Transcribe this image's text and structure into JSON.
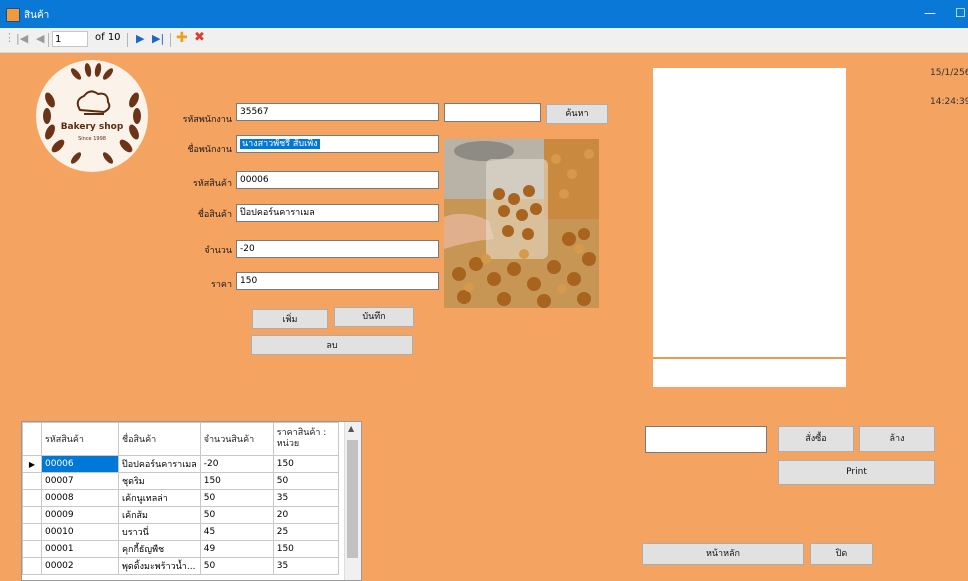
{
  "window": {
    "title": "สินค้า"
  },
  "toolbar": {
    "position": "1",
    "of_label": "of 10"
  },
  "logo": {
    "brand": "Bakery shop",
    "since": "Since 1998"
  },
  "form": {
    "employee_id_label": "รหัสพนักงาน",
    "employee_id": "35567",
    "employee_name_label": "ชื่อพนักงาน",
    "employee_name": "นางสาวพัชรี สับเพิ่ง",
    "product_id_label": "รหัสสินค้า",
    "product_id": "00006",
    "product_name_label": "ชื่อสินค้า",
    "product_name": "ป๊อปคอร์นคาราเมล",
    "quantity_label": "จำนวน",
    "quantity": "-20",
    "price_label": "ราคา",
    "price": "150",
    "search_value": "",
    "search_button": "ค้นหา",
    "add_button": "เพิ่ม",
    "save_button": "บันทึก",
    "delete_button": "ลบ"
  },
  "status": {
    "date": "15/1/256",
    "time": "14:24:39"
  },
  "right": {
    "order_input": "",
    "order_button": "สั่งซื้อ",
    "clear_button": "ล้าง",
    "print_button": "Print",
    "home_button": "หน้าหลัก",
    "close_button": "ปิด"
  },
  "grid": {
    "columns": [
      "รหัสสินค้า",
      "ชื่อสินค้า",
      "จำนวนสินค้า",
      "ราคาสินค้า : หน่วย"
    ],
    "rows": [
      [
        "00006",
        "ป๊อปคอร์นคาราเมล",
        "-20",
        "150"
      ],
      [
        "00007",
        "ชุดริม",
        "150",
        "50"
      ],
      [
        "00008",
        "เค้กนูเทลล่า",
        "50",
        "35"
      ],
      [
        "00009",
        "เค้กส้ม",
        "50",
        "20"
      ],
      [
        "00010",
        "บราวนี่",
        "45",
        "25"
      ],
      [
        "00001",
        "คุกกี้ธัญพืช",
        "49",
        "150"
      ],
      [
        "00002",
        "พุดดิ้งมะพร้าวน้ำ...",
        "50",
        "35"
      ]
    ]
  },
  "colors": {
    "background": "#F4A361",
    "titlebar": "#0A78D7"
  }
}
